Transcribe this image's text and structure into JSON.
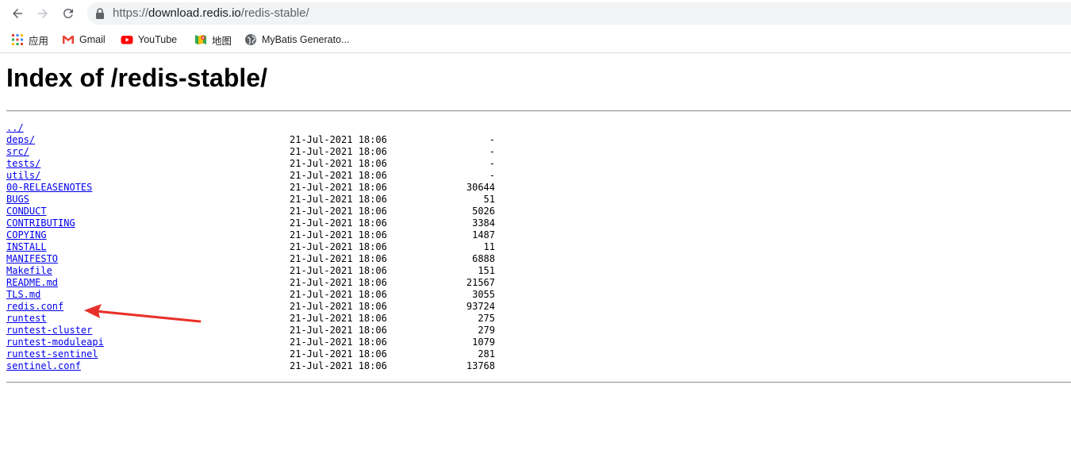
{
  "browser": {
    "url_scheme": "https://",
    "url_host": "download.redis.io",
    "url_path": "/redis-stable/",
    "bookmarks": [
      {
        "label": "应用",
        "icon": "apps-grid-icon"
      },
      {
        "label": "Gmail",
        "icon": "gmail-icon"
      },
      {
        "label": "YouTube",
        "icon": "youtube-icon"
      },
      {
        "label": "地图",
        "icon": "maps-icon"
      },
      {
        "label": "MyBatis Generato...",
        "icon": "globe-icon"
      }
    ]
  },
  "page": {
    "title": "Index of /redis-stable/"
  },
  "listing": [
    {
      "name": "../",
      "date": "",
      "size": ""
    },
    {
      "name": "deps/",
      "date": "21-Jul-2021 18:06",
      "size": "-"
    },
    {
      "name": "src/",
      "date": "21-Jul-2021 18:06",
      "size": "-"
    },
    {
      "name": "tests/",
      "date": "21-Jul-2021 18:06",
      "size": "-"
    },
    {
      "name": "utils/",
      "date": "21-Jul-2021 18:06",
      "size": "-"
    },
    {
      "name": "00-RELEASENOTES",
      "date": "21-Jul-2021 18:06",
      "size": "30644"
    },
    {
      "name": "BUGS",
      "date": "21-Jul-2021 18:06",
      "size": "51"
    },
    {
      "name": "CONDUCT",
      "date": "21-Jul-2021 18:06",
      "size": "5026"
    },
    {
      "name": "CONTRIBUTING",
      "date": "21-Jul-2021 18:06",
      "size": "3384"
    },
    {
      "name": "COPYING",
      "date": "21-Jul-2021 18:06",
      "size": "1487"
    },
    {
      "name": "INSTALL",
      "date": "21-Jul-2021 18:06",
      "size": "11"
    },
    {
      "name": "MANIFESTO",
      "date": "21-Jul-2021 18:06",
      "size": "6888"
    },
    {
      "name": "Makefile",
      "date": "21-Jul-2021 18:06",
      "size": "151"
    },
    {
      "name": "README.md",
      "date": "21-Jul-2021 18:06",
      "size": "21567"
    },
    {
      "name": "TLS.md",
      "date": "21-Jul-2021 18:06",
      "size": "3055"
    },
    {
      "name": "redis.conf",
      "date": "21-Jul-2021 18:06",
      "size": "93724"
    },
    {
      "name": "runtest",
      "date": "21-Jul-2021 18:06",
      "size": "275"
    },
    {
      "name": "runtest-cluster",
      "date": "21-Jul-2021 18:06",
      "size": "279"
    },
    {
      "name": "runtest-moduleapi",
      "date": "21-Jul-2021 18:06",
      "size": "1079"
    },
    {
      "name": "runtest-sentinel",
      "date": "21-Jul-2021 18:06",
      "size": "281"
    },
    {
      "name": "sentinel.conf",
      "date": "21-Jul-2021 18:06",
      "size": "13768"
    }
  ],
  "colors": {
    "link": "#0000ee",
    "annotation_arrow": "#e8302a"
  }
}
